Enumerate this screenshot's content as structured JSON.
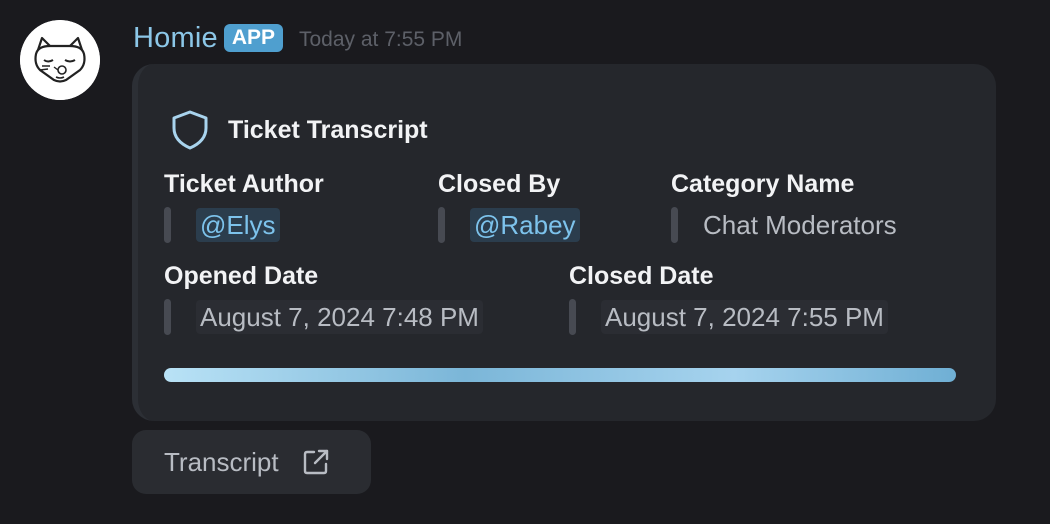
{
  "message": {
    "author": "Homie",
    "badge": "APP",
    "timestamp": "Today at 7:55 PM",
    "avatar_icon": "cat-avatar-icon"
  },
  "embed": {
    "icon": "shield-icon",
    "title": "Ticket Transcript",
    "fields": {
      "ticket_author": {
        "name": "Ticket Author",
        "value": "@Elys"
      },
      "closed_by": {
        "name": "Closed By",
        "value": "@Rabey"
      },
      "category_name": {
        "name": "Category Name",
        "value": "Chat Moderators"
      },
      "opened_date": {
        "name": "Opened Date",
        "value": "August 7, 2024 7:48 PM"
      },
      "closed_date": {
        "name": "Closed Date",
        "value": "August 7, 2024 7:55 PM"
      }
    },
    "colors": {
      "embed_background": "#25272c",
      "mention_text": "#7dc3ec",
      "username": "#8cc7e8",
      "badge_background": "#4f9fcf"
    }
  },
  "button": {
    "label": "Transcript",
    "icon": "external-link-icon"
  }
}
